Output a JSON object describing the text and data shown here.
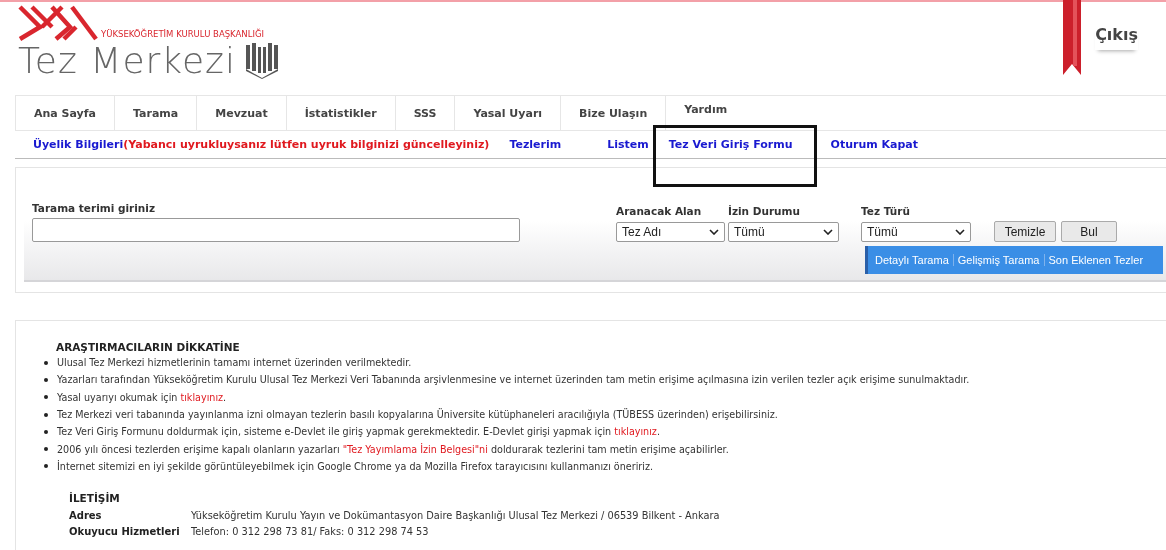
{
  "header": {
    "org_name": "YÜKSEKÖĞRETİM KURULU BAŞKANLIĞI",
    "site_title": "Tez Merkezi",
    "logout": "Çıkış"
  },
  "nav_tabs": [
    {
      "label": "Ana Sayfa"
    },
    {
      "label": "Tarama"
    },
    {
      "label": "Mevzuat"
    },
    {
      "label": "İstatistikler"
    },
    {
      "label": "SSS"
    },
    {
      "label": "Yasal Uyarı"
    },
    {
      "label": "Bize Ulaşın"
    },
    {
      "label": "Yardım"
    }
  ],
  "user_links": [
    {
      "label": "Üyelik Bilgileri",
      "note": "(Yabancı uyrukluysanız lütfen uyruk bilginizi güncelleyiniz)"
    },
    {
      "label": "Tezlerim"
    },
    {
      "label": "Listem"
    },
    {
      "label": "Tez  Veri Giriş Formu",
      "highlighted": true
    },
    {
      "label": "Oturum Kapat"
    }
  ],
  "search": {
    "term_label": "Tarama terimi giriniz",
    "filters": [
      {
        "label": "Aranacak Alan",
        "value": "Tez Adı"
      },
      {
        "label": "İzin Durumu",
        "value": "Tümü"
      },
      {
        "label": "Tez Türü",
        "value": "Tümü"
      }
    ],
    "buttons": [
      "Temizle",
      "Bul"
    ],
    "links": [
      "Detaylı Tarama",
      "Gelişmiş Tarama",
      "Son Eklenen Tezler"
    ]
  },
  "notice": {
    "title": "ARAŞTIRMACILARIN DİKKATİNE",
    "items": [
      [
        {
          "text": "Ulusal Tez Merkezi hizmetlerinin tamamı internet üzerinden verilmektedir."
        }
      ],
      [
        {
          "text": "Yazarları tarafından Yükseköğretim Kurulu Ulusal Tez Merkezi Veri Tabanında arşivlenmesine ve internet üzerinden tam metin erişime açılmasına izin verilen tezler açık erişime sunulmaktadır."
        }
      ],
      [
        {
          "text": "Yasal uyarıyı okumak için "
        },
        {
          "text": "tıklayınız",
          "link": true
        },
        {
          "text": "."
        }
      ],
      [
        {
          "text": "Tez Merkezi veri tabanında yayınlanma izni olmayan tezlerin basılı kopyalarına Üniversite kütüphaneleri aracılığıyla (TÜBESS üzerinden) erişebilirsiniz."
        }
      ],
      [
        {
          "text": "Tez Veri Giriş Formunu doldurmak için, sisteme e-Devlet ile giriş yapmak gerekmektedir. E-Devlet girişi yapmak için "
        },
        {
          "text": "tıklayınız",
          "link": true
        },
        {
          "text": "."
        }
      ],
      [
        {
          "text": "2006 yılı öncesi tezlerden erişime kapalı olanların yazarları "
        },
        {
          "text": "\"Tez Yayımlama İzin Belgesi\"ni",
          "link": true
        },
        {
          "text": " doldurarak tezlerini tam metin erişime açabilirler."
        }
      ],
      [
        {
          "text": "İnternet sitemizi en iyi şekilde görüntüleyebilmek için Google Chrome ya da Mozilla Firefox tarayıcısını kullanmanızı öneririz."
        }
      ]
    ]
  },
  "contact": {
    "title": "İLETİŞİM",
    "rows": [
      {
        "label": "Adres",
        "value": "Yükseköğretim Kurulu Yayın ve Dokümantasyon Daire Başkanlığı Ulusal Tez Merkezi / 06539 Bilkent - Ankara"
      },
      {
        "label": "Okuyucu Hizmetleri",
        "value": "Telefon: 0 312 298 73 81/ Faks: 0 312 298 74 53"
      }
    ]
  }
}
